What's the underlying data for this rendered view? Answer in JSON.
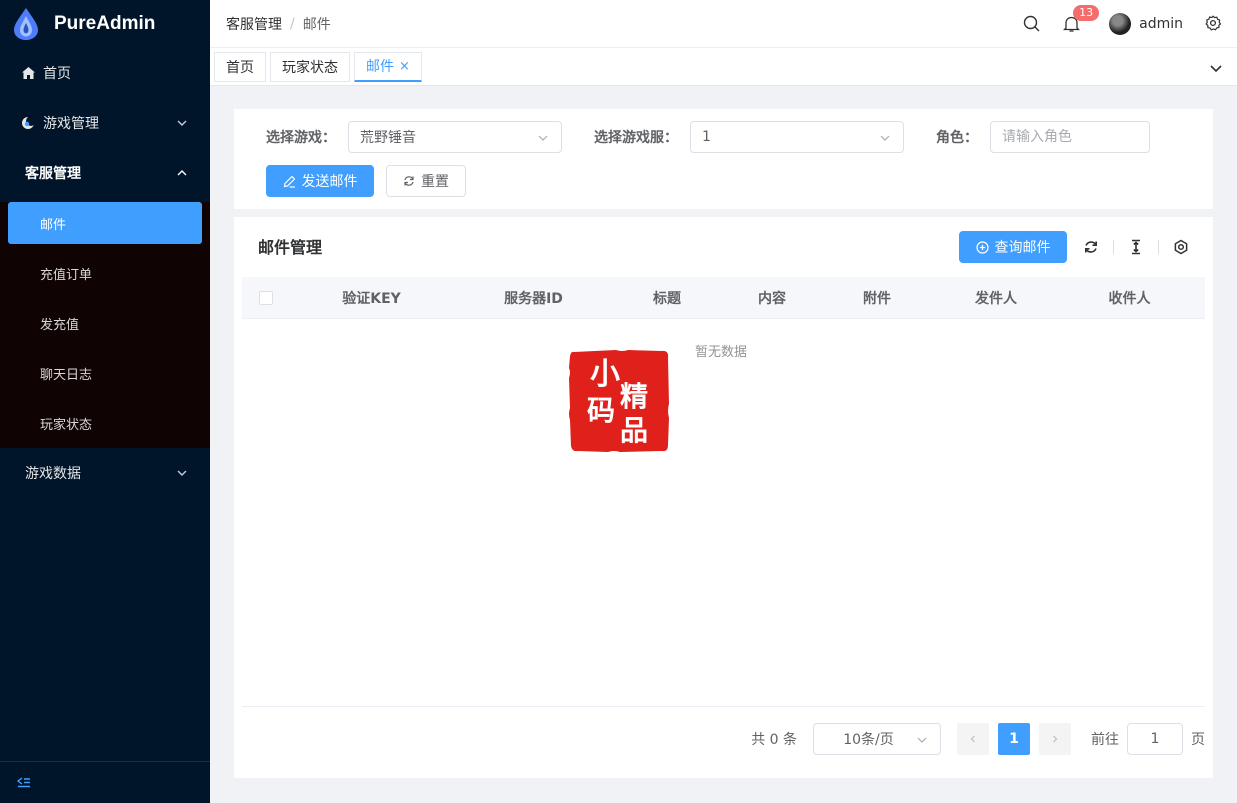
{
  "app": {
    "name": "PureAdmin"
  },
  "sidebar": {
    "items": [
      {
        "label": "首页",
        "icon": "home-icon"
      },
      {
        "label": "游戏管理",
        "icon": "moon-icon"
      },
      {
        "label": "客服管理"
      },
      {
        "label": "游戏数据"
      }
    ],
    "sub_items": [
      "邮件",
      "充值订单",
      "发充值",
      "聊天日志",
      "玩家状态"
    ]
  },
  "header": {
    "breadcrumb": [
      "客服管理",
      "/",
      "邮件"
    ],
    "notification_count": "13",
    "username": "admin"
  },
  "tabs": [
    "首页",
    "玩家状态",
    "邮件"
  ],
  "tab_close": "×",
  "search": {
    "game_label": "选择游戏：",
    "game_value": "荒野锤音",
    "server_label": "选择游戏服：",
    "server_value": "1",
    "role_label": "角色：",
    "role_placeholder": "请输入角色",
    "send_button": "发送邮件",
    "reset_button": "重置"
  },
  "table": {
    "title": "邮件管理",
    "query_button": "查询邮件",
    "columns": [
      "验证KEY",
      "服务器ID",
      "标题",
      "内容",
      "附件",
      "发件人",
      "收件人"
    ],
    "empty_text": "暂无数据",
    "seal_text": "小码精品"
  },
  "pagination": {
    "total": "共 0 条",
    "page_size": "10条/页",
    "current": "1",
    "goto_label": "前往",
    "goto_value": "1",
    "page_suffix": "页"
  },
  "colors": {
    "sidebar_bg": "#001529",
    "primary": "#409eff",
    "badge": "#f56c6c",
    "seal": "#e0201b"
  }
}
